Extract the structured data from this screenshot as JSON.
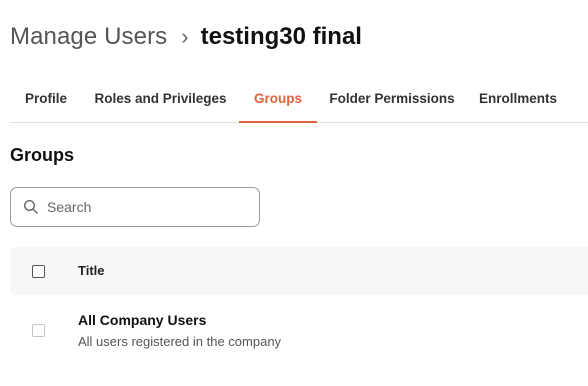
{
  "breadcrumb": {
    "parent": "Manage Users",
    "separator": "›",
    "current": "testing30 final"
  },
  "tabs": [
    {
      "label": "Profile",
      "active": false
    },
    {
      "label": "Roles and Privileges",
      "active": false
    },
    {
      "label": "Groups",
      "active": true
    },
    {
      "label": "Folder Permissions",
      "active": false
    },
    {
      "label": "Enrollments",
      "active": false
    }
  ],
  "section": {
    "title": "Groups"
  },
  "search": {
    "placeholder": "Search",
    "value": "",
    "icon": "search-icon"
  },
  "table": {
    "columns": [
      "Title"
    ],
    "rows": [
      {
        "title": "All Company Users",
        "description": "All users registered in the company",
        "checked": false
      }
    ]
  },
  "colors": {
    "accent": "#e0623f",
    "text_primary": "#111111",
    "text_secondary": "#555555",
    "header_bg": "#f7f7f7",
    "divider": "#e2e2e2"
  }
}
